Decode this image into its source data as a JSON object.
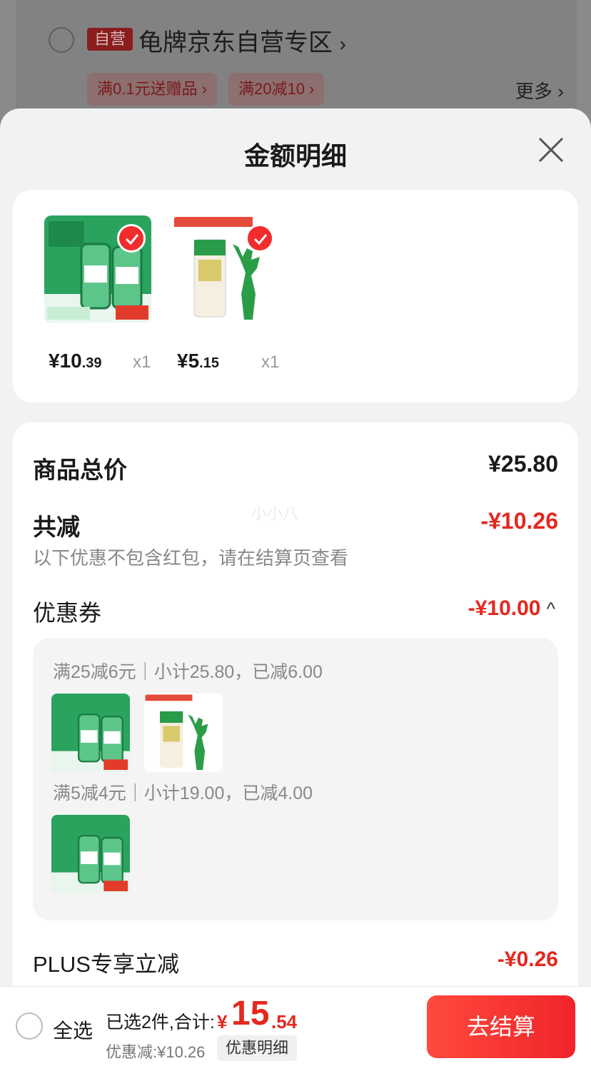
{
  "background": {
    "self_tag": "自营",
    "store_name": "龟牌京东自营专区",
    "store_chevron": "›",
    "promos": [
      "满0.1元送赠品 ›",
      "满20减10 ›"
    ],
    "more": "更多 ›"
  },
  "sheet": {
    "title": "金额明细",
    "close_icon": "close-icon"
  },
  "products": [
    {
      "price_int": "¥10",
      "price_dec": ".39",
      "qty": "x1",
      "checked": true
    },
    {
      "price_int": "¥5",
      "price_dec": ".15",
      "qty": "x1",
      "checked": true
    }
  ],
  "summary_rows": {
    "total_label": "商品总价",
    "total_value": "¥25.80",
    "discount_label": "共减",
    "discount_value": "-¥10.26",
    "hint": "以下优惠不包含红包，请在结算页查看",
    "watermark": "小小八",
    "coupon_label": "优惠券",
    "coupon_value": "-¥10.00",
    "coupon_chevron": "^",
    "plus_label": "PLUS专享立减",
    "plus_value": "-¥0.26"
  },
  "coupon_details": [
    {
      "text": "满25减6元｜小计25.80，已减6.00"
    },
    {
      "text": "满5减4元｜小计19.00，已减4.00"
    }
  ],
  "bottom_bar": {
    "select_all": "全选",
    "selected_text": "已选2件,合计:",
    "total_symbol": "¥",
    "total_int": "15",
    "total_dec": ".54",
    "saved_text": "优惠减:¥10.26",
    "detail_button": "优惠明细",
    "checkout_button": "去结算"
  },
  "colors": {
    "accent_red": "#e4281f",
    "product_green": "#1f9a4e"
  }
}
